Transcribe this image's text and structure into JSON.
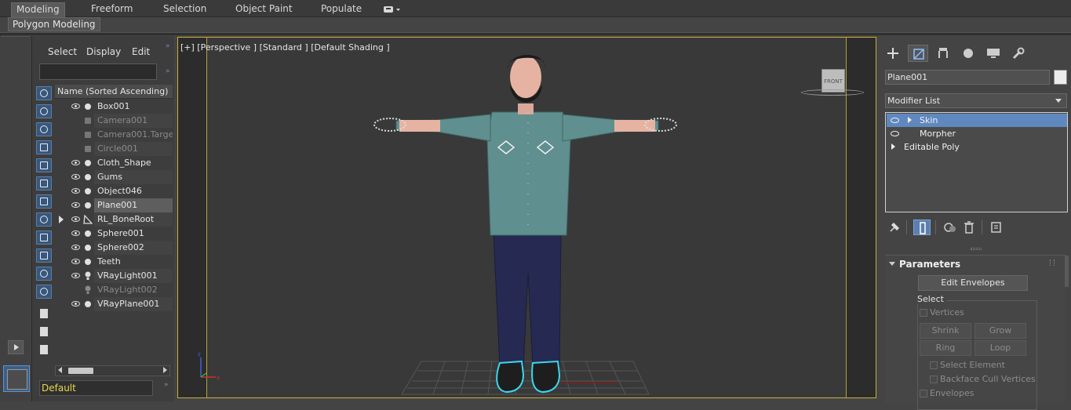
{
  "ribbon": {
    "tabs": [
      "Modeling",
      "Freeform",
      "Selection",
      "Object Paint",
      "Populate"
    ],
    "active_tab": "Modeling",
    "subtab": "Polygon Modeling"
  },
  "explorer": {
    "menus": [
      "Select",
      "Display",
      "Edit"
    ],
    "search_value": "",
    "column_header": "Name (Sorted Ascending)",
    "rows": [
      {
        "name": "Box001",
        "visible": true,
        "dim": false,
        "selected": false
      },
      {
        "name": "Camera001",
        "visible": false,
        "dim": true,
        "selected": false
      },
      {
        "name": "Camera001.Target",
        "visible": false,
        "dim": true,
        "selected": false
      },
      {
        "name": "Circle001",
        "visible": false,
        "dim": true,
        "selected": false
      },
      {
        "name": "Cloth_Shape",
        "visible": true,
        "dim": false,
        "selected": false
      },
      {
        "name": "Gums",
        "visible": true,
        "dim": false,
        "selected": false
      },
      {
        "name": "Object046",
        "visible": true,
        "dim": false,
        "selected": false
      },
      {
        "name": "Plane001",
        "visible": true,
        "dim": false,
        "selected": true
      },
      {
        "name": "RL_BoneRoot",
        "visible": true,
        "dim": false,
        "selected": false,
        "expandable": true
      },
      {
        "name": "Sphere001",
        "visible": true,
        "dim": false,
        "selected": false
      },
      {
        "name": "Sphere002",
        "visible": true,
        "dim": false,
        "selected": false
      },
      {
        "name": "Teeth",
        "visible": true,
        "dim": false,
        "selected": false
      },
      {
        "name": "VRayLight001",
        "visible": true,
        "dim": false,
        "selected": false
      },
      {
        "name": "VRayLight002",
        "visible": false,
        "dim": true,
        "selected": false
      },
      {
        "name": "VRayPlane001",
        "visible": true,
        "dim": false,
        "selected": false
      }
    ],
    "layer": "Default"
  },
  "viewport": {
    "label": "[+] [Perspective ] [Standard ] [Default Shading ]",
    "viewcube_face": "FRONT",
    "colors": {
      "shirt": "#5f8f8e",
      "pants": "#262a52",
      "skin": "#e6b3a3",
      "hair": "#1b1b1b",
      "selection": "#3ad6f0"
    }
  },
  "command_panel": {
    "object_name": "Plane001",
    "modifier_list": "Modifier List",
    "stack": [
      {
        "label": "Skin",
        "selected": true
      },
      {
        "label": "Morpher",
        "selected": false
      },
      {
        "label": "Editable Poly",
        "selected": false
      }
    ],
    "params": {
      "title": "Parameters",
      "edit_envelopes": "Edit Envelopes",
      "select_label": "Select",
      "vertices": "Vertices",
      "shrink": "Shrink",
      "grow": "Grow",
      "ring": "Ring",
      "loop": "Loop",
      "select_element": "Select Element",
      "backface": "Backface Cull Vertices",
      "envelopes": "Envelopes"
    }
  }
}
